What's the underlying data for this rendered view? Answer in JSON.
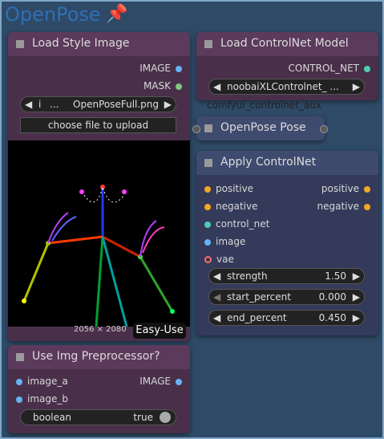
{
  "group": {
    "title": "OpenPose"
  },
  "load_style": {
    "title": "Load Style Image",
    "outputs": [
      "IMAGE",
      "MASK"
    ],
    "file": {
      "prefix": "i",
      "value": "OpenPoseFull.png"
    },
    "upload": "choose file to upload",
    "size": "2056 × 2080",
    "badge": "Easy-Use"
  },
  "load_controlnet": {
    "title": "Load ControlNet Model",
    "output": "CONTROL_NET",
    "model": "noobaiXLControlnet_ ...",
    "hidden_text": "comfyui_controlnet_aux"
  },
  "openpose_pose": {
    "title": "OpenPose Pose"
  },
  "apply": {
    "title": "Apply ControlNet",
    "inputs": [
      "positive",
      "negative",
      "control_net",
      "image",
      "vae"
    ],
    "outputs": [
      "positive",
      "negative"
    ],
    "widgets": [
      {
        "label": "strength",
        "value": "1.50"
      },
      {
        "label": "start_percent",
        "value": "0.000"
      },
      {
        "label": "end_percent",
        "value": "0.450"
      }
    ]
  },
  "use_img": {
    "title": "Use Img Preprocessor?",
    "inputs": [
      "image_a",
      "image_b"
    ],
    "output": "IMAGE",
    "toggle": {
      "label": "boolean",
      "value": "true"
    }
  },
  "colors": {
    "image": "#64b5f6",
    "mask": "#81c784",
    "control": "#4dd0b0",
    "cond": "#f5a623",
    "vae": "#ff6b6b"
  }
}
